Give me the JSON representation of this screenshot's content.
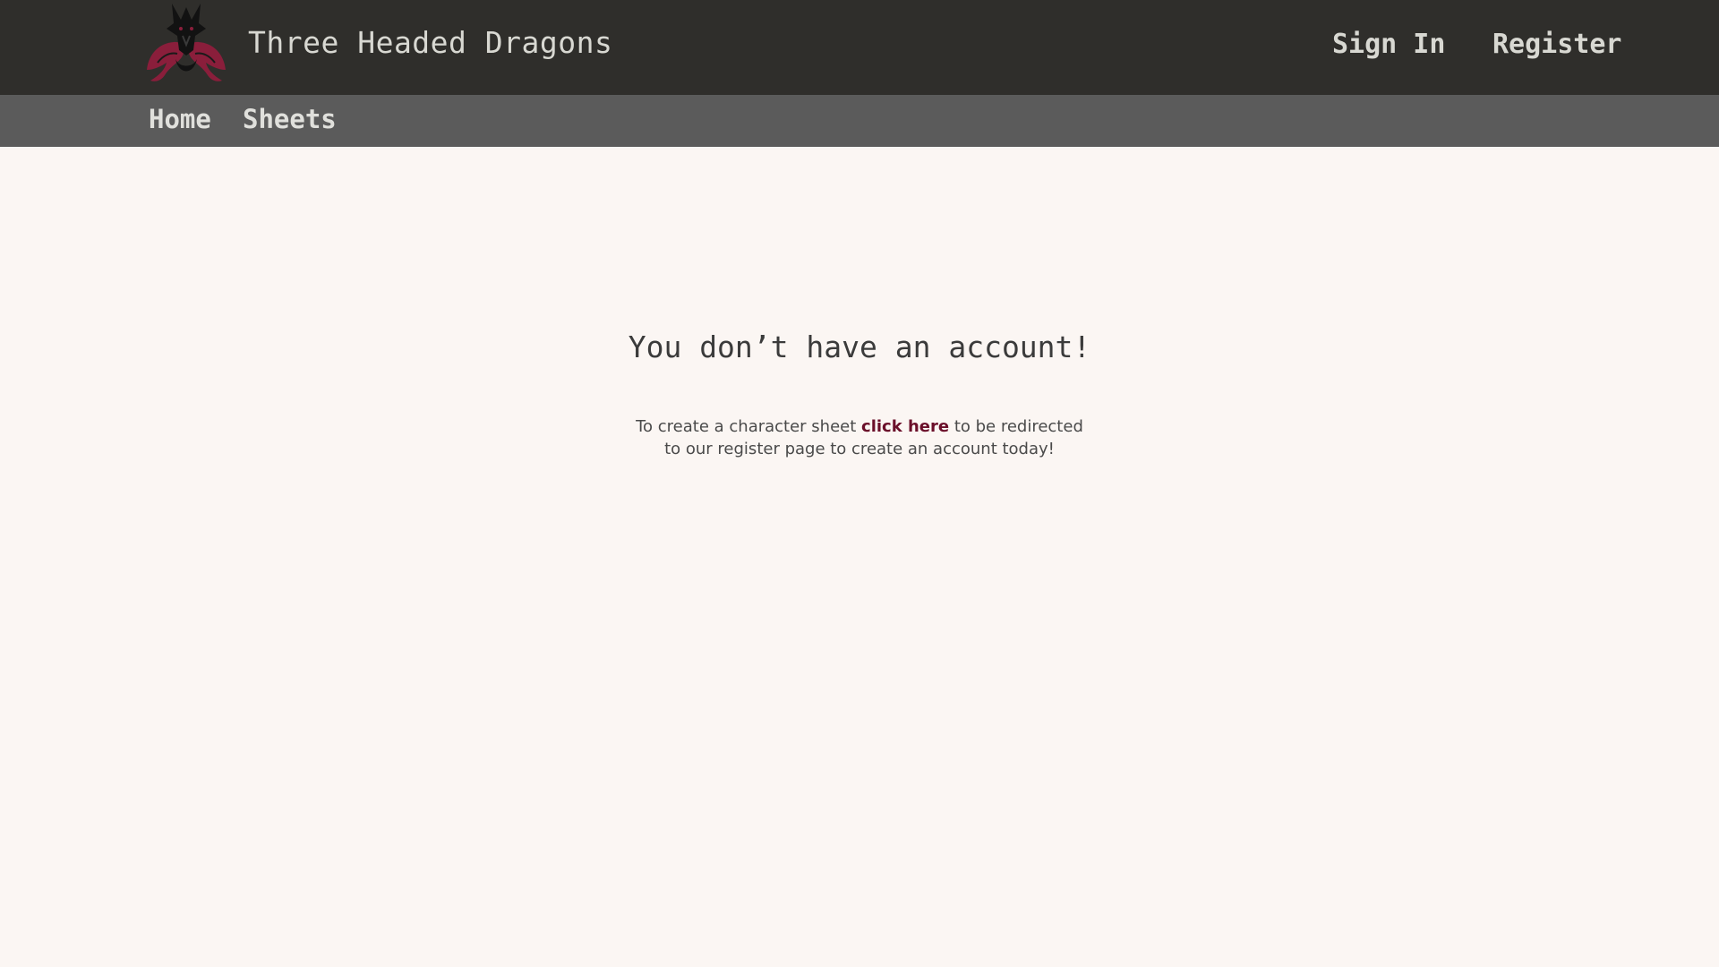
{
  "header": {
    "site_title": "Three Headed Dragons",
    "auth": {
      "sign_in": "Sign In",
      "register": "Register"
    }
  },
  "nav": {
    "items": [
      {
        "label": "Home"
      },
      {
        "label": "Sheets"
      }
    ]
  },
  "main": {
    "heading": "You don’t have an account!",
    "message_before": "To create a character sheet",
    "cta_link": "click here",
    "message_after": "to be redirected to our register page to create an account today!"
  },
  "colors": {
    "topbar": "#2F2E2B",
    "navbar": "#5B5B5B",
    "background": "#FBF6F3",
    "accent": "#6B0F2A",
    "logo_red": "#8A1E3B"
  },
  "icons": {
    "logo": "three-headed-dragon-logo-icon"
  }
}
